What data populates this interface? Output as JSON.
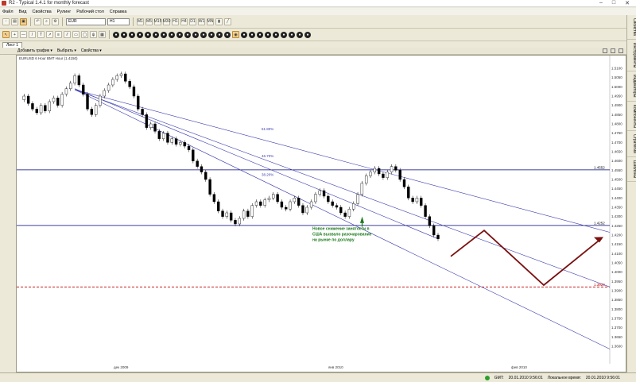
{
  "window": {
    "title": "R2 - Typical 1.4.1 for monthly forecast"
  },
  "menu": [
    "Файл",
    "Вид",
    "Свойства",
    "Рулинг",
    "Рабочий стол",
    "Справка"
  ],
  "toolbar": {
    "symbol": "EUR",
    "timeframe": "H1",
    "tf_buttons": [
      "M1",
      "M5",
      "M15",
      "M30",
      "H1",
      "H4",
      "D1",
      "W1",
      "MN"
    ]
  },
  "tabs": [
    "Лист 1"
  ],
  "subbar": {
    "add_chart": "Добавить график ▾",
    "select": "Выбрать ▾",
    "properties": "Свойства ▾"
  },
  "chart": {
    "header": "EURUSD 6 Hour BMT Hour (1.4150)",
    "fib_labels": [
      "61.80%",
      "46.70%",
      "38.20%"
    ],
    "level_labels": [
      "1.4552",
      "1.4252",
      "1.3920"
    ],
    "annotation": "Новое снижение занятости в США вызвало разочарование на рынке по доллару",
    "x_labels": [
      "дек 2009",
      "янв 2010",
      "фев 2010"
    ],
    "y_labels": [
      "1.5100",
      "1.5050",
      "1.5000",
      "1.4950",
      "1.4900",
      "1.4850",
      "1.4800",
      "1.4750",
      "1.4700",
      "1.4650",
      "1.4600",
      "1.4550",
      "1.4500",
      "1.4450",
      "1.4400",
      "1.4350",
      "1.4300",
      "1.4250",
      "1.4200",
      "1.4150",
      "1.4100",
      "1.4050",
      "1.4000",
      "1.3950",
      "1.3900",
      "1.3850",
      "1.3800",
      "1.3750",
      "1.3700",
      "1.3650",
      "1.3600"
    ]
  },
  "right_panel": [
    "Свойства",
    "Инструменты",
    "Индикаторы",
    "Компоненты",
    "Стратегии",
    "Шаблоны"
  ],
  "status": {
    "gmt_label": "GMT:",
    "gmt_time": "20.01.2010 9:56:01",
    "local_label": "Локальное время:",
    "local_time": "20.01.2010 9:56:01"
  },
  "colors": {
    "candle": "#000000",
    "trend": "#3a3ab0",
    "level": "#000080",
    "dashed": "#c00000",
    "forecast": "#7a1010",
    "annotation": "#1a7a1a"
  }
}
